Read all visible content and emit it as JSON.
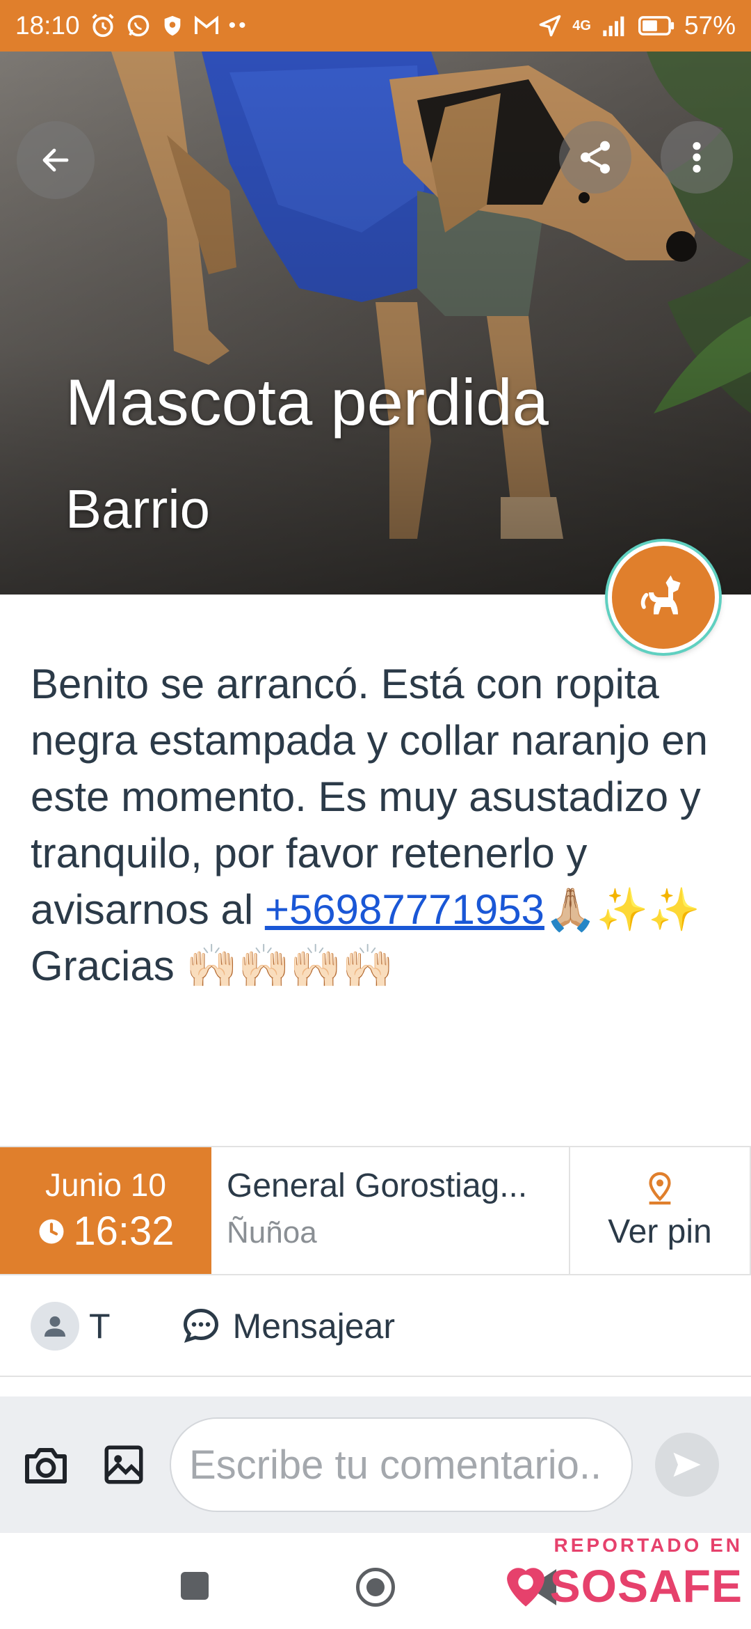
{
  "status_bar": {
    "time": "18:10",
    "network": "4G",
    "battery": "57%",
    "left_icons": [
      "alarm-icon",
      "whatsapp-icon",
      "shield-icon",
      "gmail-icon",
      "more-dots-icon"
    ],
    "right_icons": [
      "location-arrow-icon",
      "signal-icon",
      "battery-icon"
    ]
  },
  "hero": {
    "title": "Mascota perdida",
    "subtitle": "Barrio",
    "badge_icon": "dog-icon"
  },
  "post": {
    "text_part1": "Benito se arrancó. Está con ropita negra estampada y collar naranjo en este momento. Es muy asustadizo y tranquilo, por favor retenerlo y avisarnos al ",
    "phone": "+56987771953",
    "text_part2": "🙏🏼✨✨ Gracias 🙌🏻🙌🏻🙌🏻🙌🏻"
  },
  "info": {
    "date": "Junio 10",
    "time": "16:32",
    "street": "General Gorostiag...",
    "commune": "Ñuñoa",
    "pin_label": "Ver pin"
  },
  "user": {
    "name": "T",
    "message_label": "Mensajear"
  },
  "comment": {
    "placeholder": "Escribe tu comentario.."
  },
  "brand": {
    "prefix": "REPORTADO EN",
    "name": "SOSAFE"
  },
  "colors": {
    "accent": "#e07f2c",
    "brand": "#e6416c",
    "link": "#1a57d6",
    "text": "#2b3a48"
  }
}
